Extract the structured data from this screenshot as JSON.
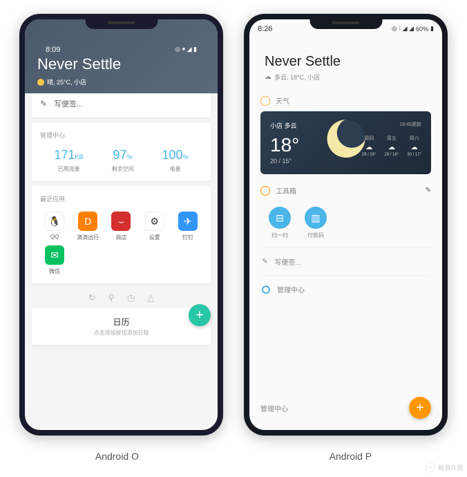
{
  "phoneO": {
    "time": "8:09",
    "title": "Never Settle",
    "weather": "晴, 25°C, 小店",
    "memo": "写便签...",
    "mgmt_title": "管理中心",
    "stats": [
      {
        "value": "171",
        "unit": "KB",
        "label": "已用流量"
      },
      {
        "value": "97",
        "unit": "%",
        "label": "剩余空间"
      },
      {
        "value": "100",
        "unit": "%",
        "label": "电量"
      }
    ],
    "recent_title": "最近应用",
    "apps": [
      {
        "name": "QQ"
      },
      {
        "name": "滴滴出行"
      },
      {
        "name": "商店"
      },
      {
        "name": "设置"
      },
      {
        "name": "钉钉"
      },
      {
        "name": "微信"
      }
    ],
    "calendar": {
      "title": "日历",
      "sub": "点击添加按钮添加日程"
    }
  },
  "phoneP": {
    "time": "8:26",
    "battery": "60%",
    "title": "Never Settle",
    "weather_line": "多云, 18°C, 小店",
    "weather_section": "天气",
    "card": {
      "loc": "小店  多云",
      "updated": "19:49更新",
      "temp": "18°",
      "range": "20 / 15°",
      "forecast": [
        {
          "day": "周四",
          "temps": "29 / 16°"
        },
        {
          "day": "周五",
          "temps": "29 / 16°"
        },
        {
          "day": "周六",
          "temps": "30 / 17°"
        }
      ]
    },
    "toolbox": "工具箱",
    "tools": [
      {
        "name": "扫一扫"
      },
      {
        "name": "付款码"
      }
    ],
    "memo": "写便签...",
    "mgmt": "管理中心",
    "bottom": "管理中心"
  },
  "labels": {
    "left": "Android O",
    "right": "Android P"
  },
  "watermark": "新浪众测"
}
